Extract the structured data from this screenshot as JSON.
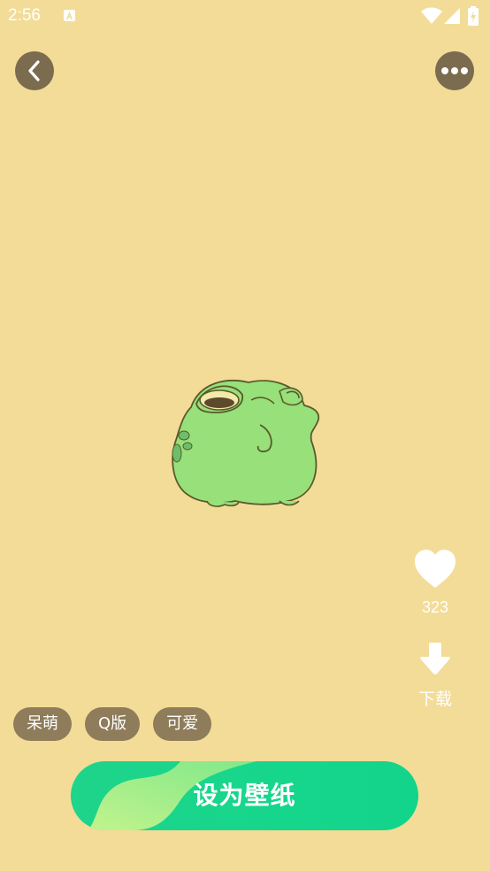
{
  "status_bar": {
    "time": "2:56",
    "notification_icon": "a-icon",
    "icons": [
      "wifi-icon",
      "cell-signal-icon",
      "battery-charging-icon"
    ]
  },
  "header": {
    "back_icon": "chevron-left-icon",
    "more_icon": "more-horizontal-icon"
  },
  "wallpaper": {
    "subject": "frog-icon",
    "background_color": "#f2dc98"
  },
  "actions": {
    "like_icon": "heart-icon",
    "like_count": "323",
    "download_icon": "download-arrow-icon",
    "download_label": "下载"
  },
  "tags": [
    {
      "label": "呆萌"
    },
    {
      "label": "Q版"
    },
    {
      "label": "可爱"
    }
  ],
  "primary_action": {
    "label": "设为壁纸",
    "color_start": "#a5f089",
    "color_end": "#12d48a"
  },
  "colors": {
    "button_dark": "#7b6c4f",
    "tag_bg": "#8e7c5a",
    "frog_green": "#97e07a"
  }
}
